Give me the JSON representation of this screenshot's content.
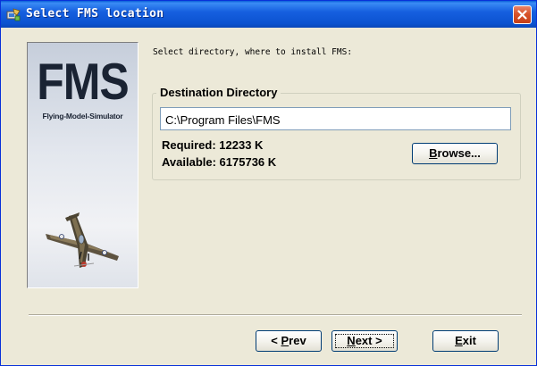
{
  "window": {
    "title": "Select FMS location",
    "title_icon": "setup-icon",
    "close_icon": "close-icon"
  },
  "banner": {
    "logo_text": "FMS",
    "subtitle": "Flying-Model-Simulator",
    "image": "airplane-illustration"
  },
  "content": {
    "instruction": "Select directory, where to install FMS:",
    "group_title": "Destination Directory",
    "path_value": "C:\\Program Files\\FMS",
    "required": "Required: 12233 K",
    "available": "Available: 6175736 K"
  },
  "buttons": {
    "browse": {
      "mnemonic": "B",
      "rest": "rowse..."
    },
    "prev": {
      "prefix": "< ",
      "mnemonic": "P",
      "rest": "rev"
    },
    "next": {
      "mnemonic": "N",
      "rest": "ext >"
    },
    "exit": {
      "mnemonic": "E",
      "rest": "xit"
    }
  },
  "colors": {
    "titlebar": "#0a52d0",
    "dialog_bg": "#ece9d8",
    "close_button": "#d8532a"
  }
}
